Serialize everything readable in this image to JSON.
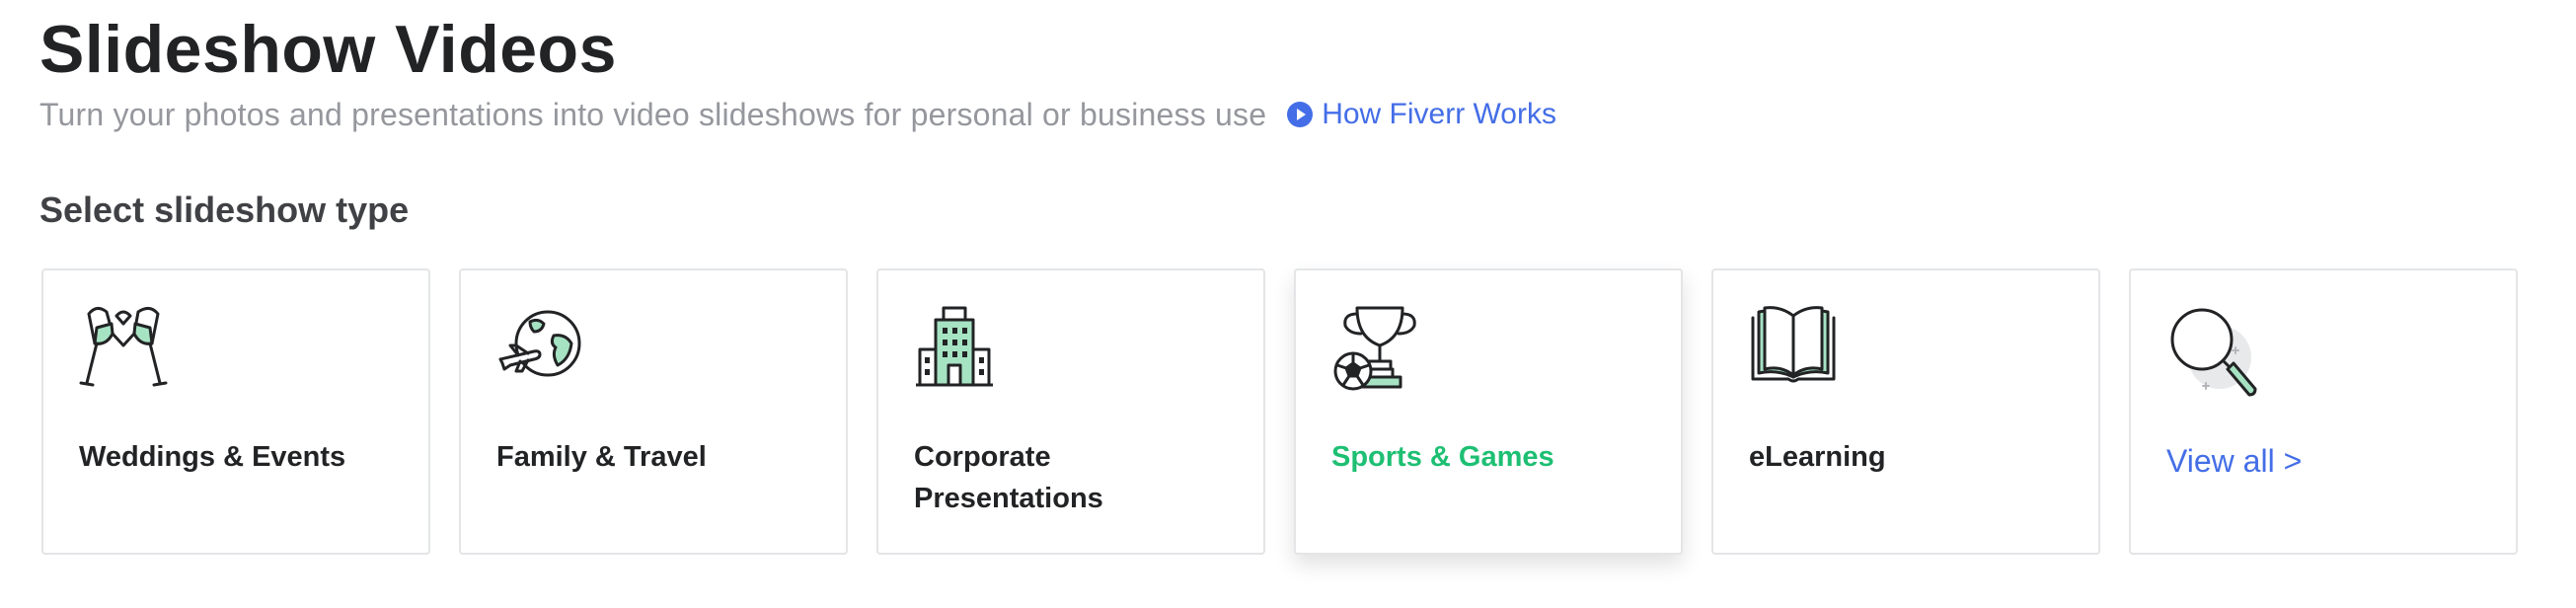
{
  "header": {
    "title": "Slideshow Videos",
    "subtitle": "Turn your photos and presentations into video slideshows for personal or business use",
    "how_link_label": "How Fiverr Works"
  },
  "section": {
    "title": "Select slideshow type"
  },
  "cards": [
    {
      "label": "Weddings & Events",
      "icon": "champagne-glasses-icon"
    },
    {
      "label": "Family & Travel",
      "icon": "globe-airplane-icon"
    },
    {
      "label": "Corporate Presentations",
      "icon": "office-building-icon"
    },
    {
      "label": "Sports & Games",
      "icon": "trophy-ball-icon",
      "active": true
    },
    {
      "label": "eLearning",
      "icon": "open-book-icon"
    },
    {
      "label": "View all >",
      "icon": "magnifier-icon"
    }
  ],
  "colors": {
    "accent_green": "#1dbf73",
    "link_blue": "#446ee7",
    "icon_mint": "#a6e3c3",
    "text_dark": "#222325",
    "text_muted": "#95979d"
  }
}
